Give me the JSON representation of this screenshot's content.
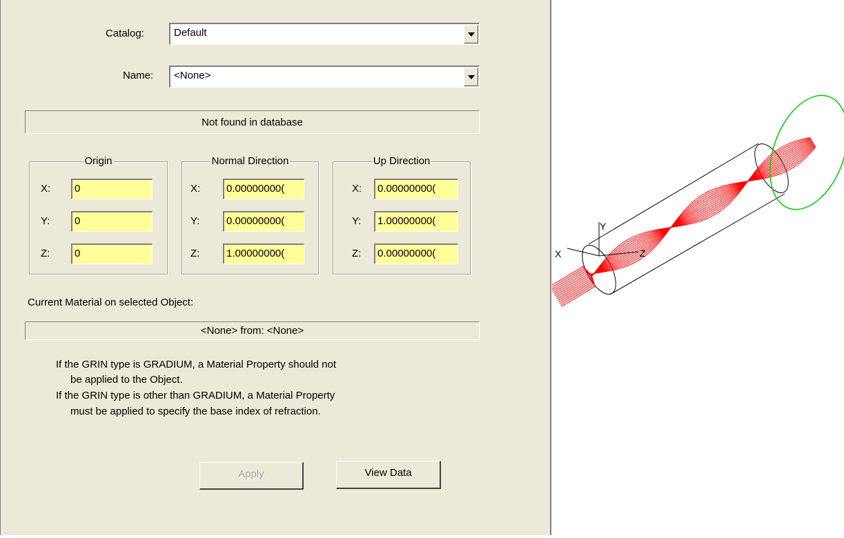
{
  "catalog": {
    "label": "Catalog:",
    "value": "Default"
  },
  "name": {
    "label": "Name:",
    "value": "<None>"
  },
  "status_text": "Not found in database",
  "groups": {
    "origin": {
      "title": "Origin",
      "x": "0",
      "y": "0",
      "z": "0"
    },
    "normal": {
      "title": "Normal Direction",
      "x": "0.00000000(",
      "y": "0.00000000(",
      "z": "1.00000000("
    },
    "up": {
      "title": "Up Direction",
      "x": "0.00000000(",
      "y": "1.00000000(",
      "z": "0.00000000("
    }
  },
  "axis_labels": {
    "x": "X:",
    "y": "Y:",
    "z": "Z:"
  },
  "current_material": {
    "label": "Current Material on selected Object:",
    "value": "<None> from: <None>"
  },
  "notes": [
    "If the GRIN type is GRADIUM, a Material Property should not",
    "be applied to the Object.",
    "If the GRIN type is other than GRADIUM, a Material Property",
    "must be applied to specify the base index of refraction."
  ],
  "buttons": {
    "apply": "Apply",
    "view_data": "View Data"
  },
  "viewport": {
    "axis_x": "X",
    "axis_y": "Y",
    "axis_z": "Z",
    "ray_color": "#ff0000",
    "ring_color": "#00cc00"
  }
}
